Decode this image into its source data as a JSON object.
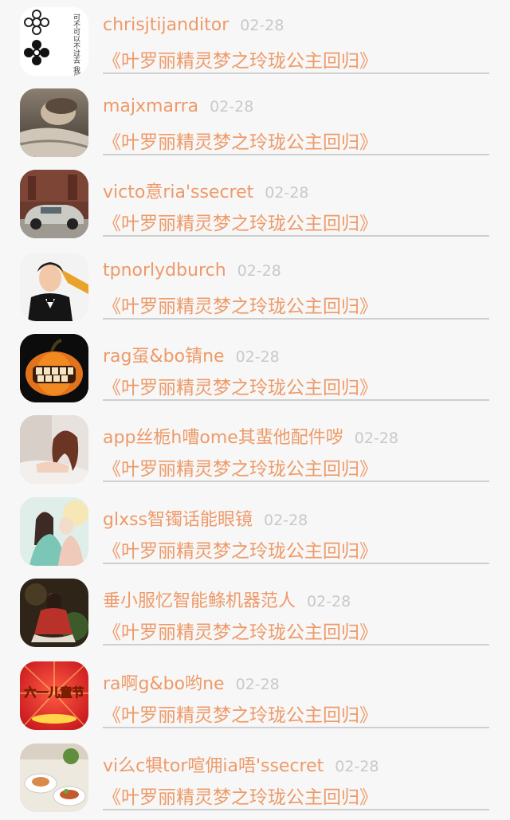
{
  "comments": [
    {
      "user": "chrisjtijanditor",
      "time": "02-28",
      "title": "《叶罗丽精灵梦之玲珑公主回归》",
      "avatar": "avatar-flowers-text"
    },
    {
      "user": "majxmarra",
      "time": "02-28",
      "title": "《叶罗丽精灵梦之玲珑公主回归》",
      "avatar": "avatar-reclining-man"
    },
    {
      "user": "victo意ria'ssecret",
      "time": "02-28",
      "title": "《叶罗丽精灵梦之玲珑公主回归》",
      "avatar": "avatar-vintage-car"
    },
    {
      "user": "tpnorlydburch",
      "time": "02-28",
      "title": "《叶罗丽精灵梦之玲珑公主回归》",
      "avatar": "avatar-man-tuxedo"
    },
    {
      "user": "rag虿&bo锖ne",
      "time": "02-28",
      "title": "《叶罗丽精灵梦之玲珑公主回归》",
      "avatar": "avatar-pumpkin"
    },
    {
      "user": "app丝栀h嘈ome其蜚他配件哕",
      "time": "02-28",
      "title": "《叶罗丽精灵梦之玲珑公主回归》",
      "avatar": "avatar-woman-reclining"
    },
    {
      "user": "glxss智镯话能眼镜",
      "time": "02-28",
      "title": "《叶罗丽精灵梦之玲珑公主回归》",
      "avatar": "avatar-anime-couple"
    },
    {
      "user": "垂小服忆智能鲦机器范人",
      "time": "02-28",
      "title": "《叶罗丽精灵梦之玲珑公主回归》",
      "avatar": "avatar-anime-dancer"
    },
    {
      "user": "ra啊g&bo哟ne",
      "time": "02-28",
      "title": "《叶罗丽精灵梦之玲珑公主回归》",
      "avatar": "avatar-festival-red"
    },
    {
      "user": "vi么c犋tor喧佣ia唔'ssecret",
      "time": "02-28",
      "title": "《叶罗丽精灵梦之玲珑公主回归》",
      "avatar": "avatar-food-plates"
    }
  ],
  "avatar_text": {
    "flowers": "可不可以不过去 我们的过去。",
    "festival": "六一儿童节"
  }
}
